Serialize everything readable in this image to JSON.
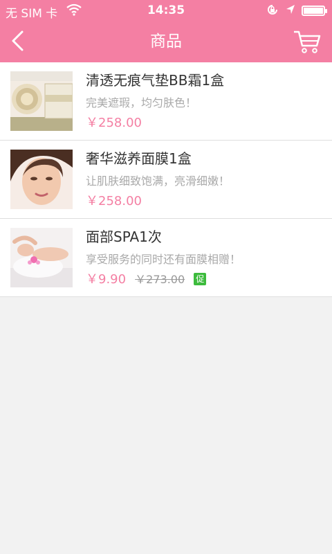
{
  "status_bar": {
    "carrier": "无 SIM 卡",
    "time": "14:35"
  },
  "nav": {
    "title": "商品"
  },
  "products": [
    {
      "name": "清透无痕气垫BB霜1盒",
      "description": "完美遮瑕，均匀肤色！",
      "price": "￥258.00"
    },
    {
      "name": "奢华滋养面膜1盒",
      "description": "让肌肤细致饱满，亮滑细嫩！",
      "price": "￥258.00"
    },
    {
      "name": "面部SPA1次",
      "description": "享受服务的同时还有面膜相赠！",
      "price": "￥9.90",
      "original_price": "￥273.00",
      "badge": "促"
    }
  ],
  "colors": {
    "accent": "#f47fa3",
    "promo_badge": "#3dbb3d",
    "background": "#f2f2f2"
  }
}
